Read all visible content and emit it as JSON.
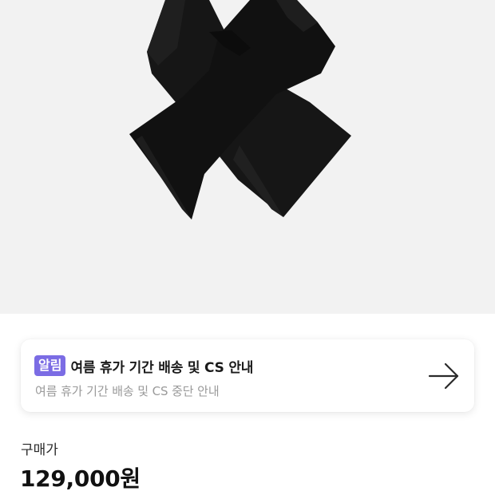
{
  "product": {
    "image_icon": "black-pants-product-photo"
  },
  "notice": {
    "badge": "알림",
    "badge_color": "#7b6ce4",
    "title": "여름 휴가 기간 배송 및 CS 안내",
    "subtitle": "여름 휴가 기간 배송 및 CS 중단 안내",
    "arrow_icon": "arrow-right-icon"
  },
  "price": {
    "label": "구매가",
    "value": "129,000원"
  },
  "colors": {
    "image_background": "#f2f2f2",
    "garment": "#141414"
  }
}
